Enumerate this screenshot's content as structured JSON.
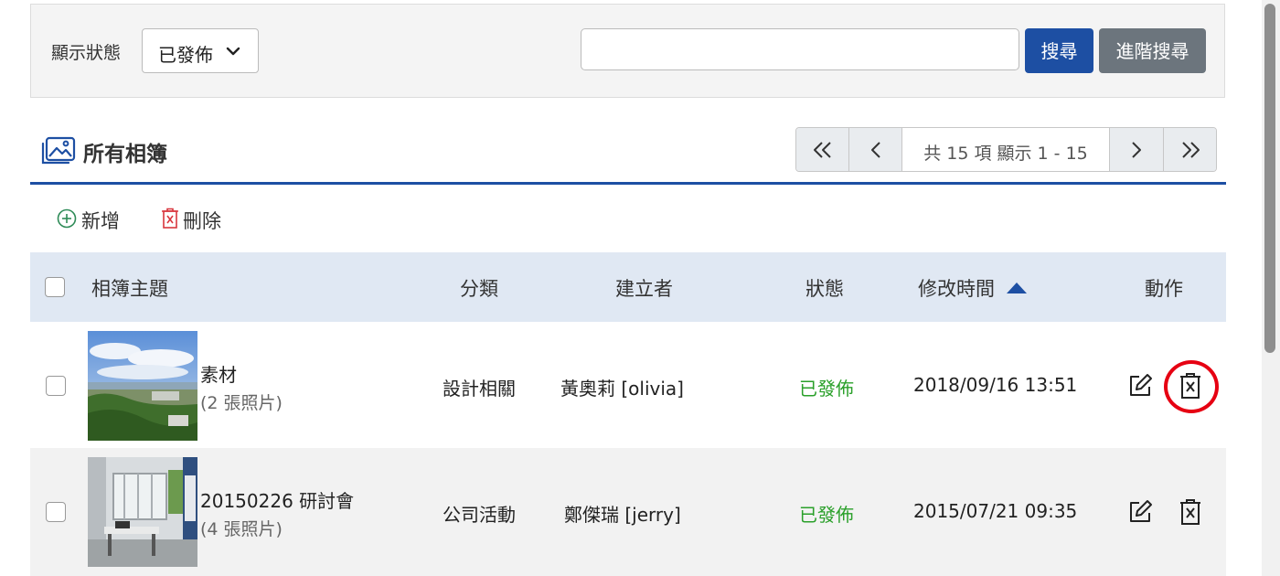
{
  "filter": {
    "label": "顯示狀態",
    "status_value": "已發佈",
    "search_placeholder": "",
    "search_button": "搜尋",
    "advanced_button": "進階搜尋"
  },
  "section": {
    "title": "所有相簿"
  },
  "pagination": {
    "info": "共 15 項 顯示 1 - 15"
  },
  "toolbar": {
    "add_label": "新增",
    "delete_label": "刪除"
  },
  "table": {
    "headers": {
      "subject": "相簿主題",
      "category": "分類",
      "creator": "建立者",
      "status": "狀態",
      "modified": "修改時間",
      "actions": "動作"
    },
    "sort_indicator": "ascending",
    "rows": [
      {
        "name": "素材",
        "photo_count": "(2 張照片)",
        "category": "設計相關",
        "creator": "黃奧莉 [olivia]",
        "status": "已發佈",
        "modified": "2018/09/16 13:51"
      },
      {
        "name": "20150226 研討會",
        "photo_count": "(4 張照片)",
        "category": "公司活動",
        "creator": "鄭傑瑞 [jerry]",
        "status": "已發佈",
        "modified": "2015/07/21 09:35"
      }
    ]
  },
  "colors": {
    "primary": "#1d4fa3",
    "secondary": "#6c757d",
    "published": "#2aa02a",
    "highlight": "#e60012",
    "header_bg": "#e0e8f3"
  },
  "icons": [
    "chevron-down-icon",
    "album-icon",
    "first-page-icon",
    "prev-page-icon",
    "next-page-icon",
    "last-page-icon",
    "add-circle-icon",
    "trash-icon",
    "edit-icon",
    "sort-asc-icon"
  ]
}
